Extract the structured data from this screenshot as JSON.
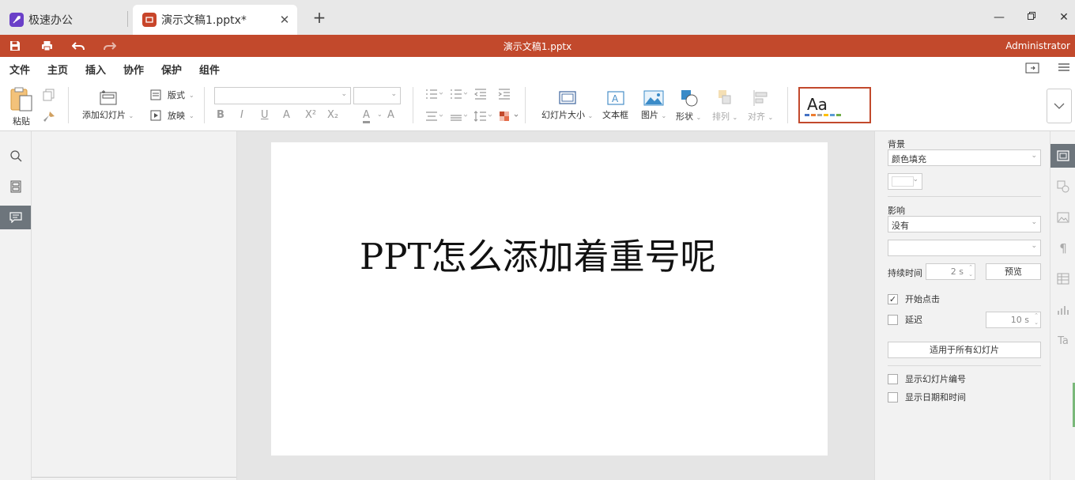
{
  "tabs": {
    "home_label": "极速办公",
    "doc_label": "演示文稿1.pptx*"
  },
  "titlebar": {
    "doc_title": "演示文稿1.pptx",
    "user": "Administrator"
  },
  "menu": {
    "items": [
      "文件",
      "主页",
      "插入",
      "协作",
      "保护",
      "组件"
    ],
    "active": "主页"
  },
  "ribbon": {
    "paste_label": "粘贴",
    "add_slide_label": "添加幻灯片",
    "layout_label": "版式",
    "play_label": "放映",
    "font_name": "",
    "font_size": "",
    "slide_size_label": "幻灯片大小",
    "textbox_label": "文本框",
    "picture_label": "图片",
    "shape_label": "形状",
    "arrange_label": "排列",
    "align_label": "对齐",
    "theme_preview": "Aa"
  },
  "slide": {
    "title": "PPT怎么添加着重号呢"
  },
  "right_panel": {
    "background_label": "背景",
    "fill_type": "颜色填充",
    "effect_label": "影响",
    "effect_value": "没有",
    "effect_sub_value": "",
    "duration_label": "持续时间",
    "duration_value": "2 s",
    "preview_button": "预览",
    "start_on_click_label": "开始点击",
    "start_on_click_checked": true,
    "delay_label": "延迟",
    "delay_checked": false,
    "delay_value": "10 s",
    "apply_all_button": "适用于所有幻灯片",
    "show_slide_number_label": "显示幻灯片编号",
    "show_datetime_label": "显示日期和时间"
  },
  "colors": {
    "accent": "#c2492c",
    "home_badge": "#6a3fc8",
    "panel_active": "#6d757c"
  }
}
